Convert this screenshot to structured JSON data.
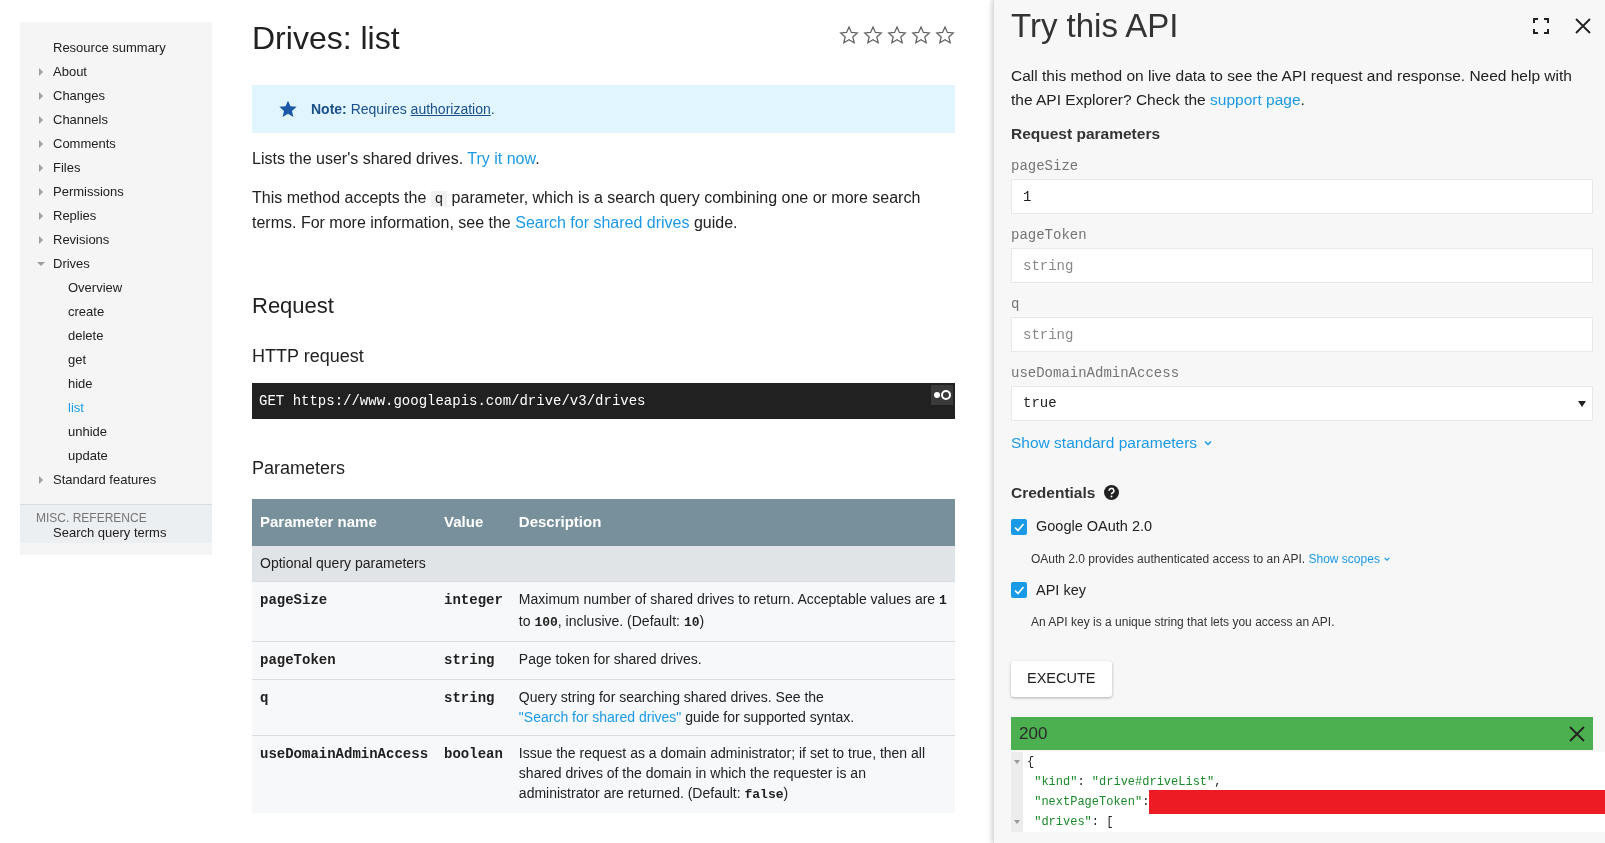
{
  "sidebar": {
    "items": [
      {
        "label": "Resource summary",
        "expandable": false,
        "selected": false
      },
      {
        "label": "About",
        "expandable": true,
        "expanded": false,
        "selected": false
      },
      {
        "label": "Changes",
        "expandable": true,
        "expanded": false,
        "selected": false
      },
      {
        "label": "Channels",
        "expandable": true,
        "expanded": false,
        "selected": false
      },
      {
        "label": "Comments",
        "expandable": true,
        "expanded": false,
        "selected": false
      },
      {
        "label": "Files",
        "expandable": true,
        "expanded": false,
        "selected": false
      },
      {
        "label": "Permissions",
        "expandable": true,
        "expanded": false,
        "selected": false
      },
      {
        "label": "Replies",
        "expandable": true,
        "expanded": false,
        "selected": false
      },
      {
        "label": "Revisions",
        "expandable": true,
        "expanded": false,
        "selected": false
      },
      {
        "label": "Drives",
        "expandable": true,
        "expanded": true,
        "selected": false,
        "children": [
          {
            "label": "Overview",
            "selected": false
          },
          {
            "label": "create",
            "selected": false
          },
          {
            "label": "delete",
            "selected": false
          },
          {
            "label": "get",
            "selected": false
          },
          {
            "label": "hide",
            "selected": false
          },
          {
            "label": "list",
            "selected": true
          },
          {
            "label": "unhide",
            "selected": false
          },
          {
            "label": "update",
            "selected": false
          }
        ]
      },
      {
        "label": "Standard features",
        "expandable": true,
        "expanded": false,
        "selected": false
      }
    ],
    "section_heading": "MISC. REFERENCE",
    "section_items": [
      {
        "label": "Search query terms",
        "selected": false
      }
    ]
  },
  "main": {
    "title": "Drives: list",
    "rating": {
      "stars": 0
    },
    "note": {
      "label": "Note:",
      "parts": [
        {
          "kind": "text",
          "text": " Requires "
        },
        {
          "kind": "underline_link",
          "text": "authorization"
        },
        {
          "kind": "text",
          "text": "."
        }
      ]
    },
    "paragraphs": [
      [
        {
          "kind": "text",
          "text": "Lists the user's shared drives. "
        },
        {
          "kind": "link",
          "text": "Try it now"
        },
        {
          "kind": "text",
          "text": "."
        }
      ],
      [
        {
          "kind": "text",
          "text": "This method accepts the "
        },
        {
          "kind": "code",
          "text": "q"
        },
        {
          "kind": "text",
          "text": " parameter, which is a search query combining one or more search terms. For more information, see the "
        },
        {
          "kind": "link",
          "text": "Search for shared drives"
        },
        {
          "kind": "text",
          "text": " guide."
        }
      ]
    ],
    "request_heading": "Request",
    "http_heading": "HTTP request",
    "http_request": {
      "method": "GET",
      "url": "https://www.googleapis.com/drive/v3/drives"
    },
    "parameters_heading": "Parameters",
    "table": {
      "columns": [
        "Parameter name",
        "Value",
        "Description"
      ],
      "group": "Optional query parameters",
      "rows": [
        {
          "name": "pageSize",
          "type": "integer",
          "description": [
            {
              "kind": "text",
              "text": "Maximum number of shared drives to return. Acceptable values are "
            },
            {
              "kind": "code",
              "text": "1"
            },
            {
              "kind": "text",
              "text": " to "
            },
            {
              "kind": "code",
              "text": "100"
            },
            {
              "kind": "text",
              "text": ", inclusive. (Default: "
            },
            {
              "kind": "code",
              "text": "10"
            },
            {
              "kind": "text",
              "text": ")"
            }
          ]
        },
        {
          "name": "pageToken",
          "type": "string",
          "description": [
            {
              "kind": "text",
              "text": "Page token for shared drives."
            }
          ]
        },
        {
          "name": "q",
          "type": "string",
          "description": [
            {
              "kind": "text",
              "text": "Query string for searching shared drives. See the "
            },
            {
              "kind": "link",
              "text": "\"Search for shared drives\""
            },
            {
              "kind": "text",
              "text": " guide for supported syntax."
            }
          ]
        },
        {
          "name": "useDomainAdminAccess",
          "type": "boolean",
          "description": [
            {
              "kind": "text",
              "text": "Issue the request as a domain administrator; if set to true, then all shared drives of the domain in which the requester is an administrator are returned. (Default: "
            },
            {
              "kind": "code",
              "text": "false"
            },
            {
              "kind": "text",
              "text": ")"
            }
          ]
        }
      ]
    }
  },
  "panel": {
    "title": "Try this API",
    "intro": [
      {
        "kind": "text",
        "text": "Call this method on live data to see the API request and response. Need help with the API Explorer? Check the "
      },
      {
        "kind": "link",
        "text": "support page"
      },
      {
        "kind": "text",
        "text": "."
      }
    ],
    "params_heading": "Request parameters",
    "fields": [
      {
        "kind": "input",
        "label": "pageSize",
        "value": "1"
      },
      {
        "kind": "input",
        "label": "pageToken",
        "placeholder": "string"
      },
      {
        "kind": "input",
        "label": "q",
        "placeholder": "string"
      },
      {
        "kind": "select",
        "label": "useDomainAdminAccess",
        "value": "true"
      }
    ],
    "standard_params_link": "Show standard parameters",
    "credentials_heading": "Credentials",
    "credentials": [
      {
        "label": "Google OAuth 2.0",
        "checked": true,
        "description": "OAuth 2.0 provides authenticated access to an API.",
        "link": "Show scopes"
      },
      {
        "label": "API key",
        "checked": true,
        "description": "An API key is a unique string that lets you access an API."
      }
    ],
    "execute_button": "EXECUTE",
    "response": {
      "status": "200",
      "lines": [
        {
          "text": "{",
          "foldable": true,
          "redacted": false
        },
        {
          "text": " \"kind\": \"drive#driveList\",",
          "foldable": false,
          "redacted": false
        },
        {
          "text": " \"nextPageToken\":",
          "foldable": false,
          "redacted": true
        },
        {
          "text": " \"drives\": [",
          "foldable": true,
          "redacted": false
        }
      ]
    }
  }
}
